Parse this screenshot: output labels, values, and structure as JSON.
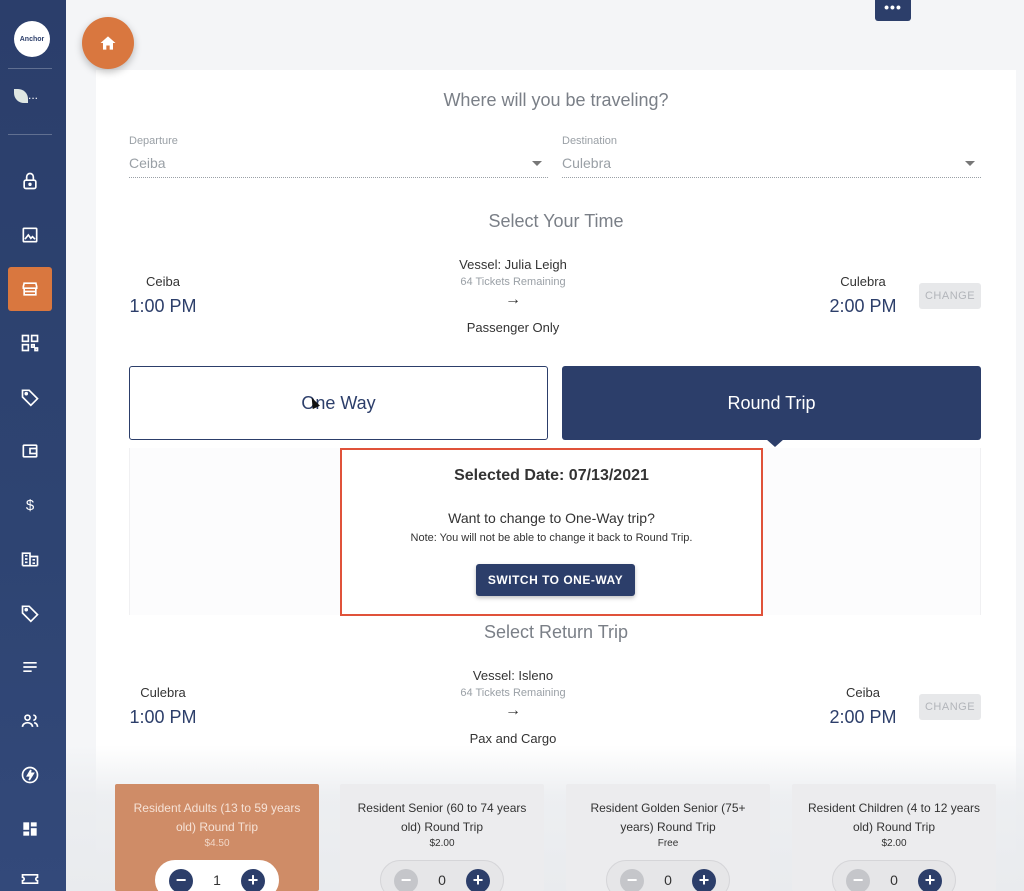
{
  "sidebar": {
    "logo_text": "Anchor",
    "org_label": "...",
    "items": [
      {
        "icon": "lock-icon"
      },
      {
        "icon": "image-icon"
      },
      {
        "icon": "storefront-icon",
        "active": true
      },
      {
        "icon": "qr-code-icon"
      },
      {
        "icon": "tag-heart-icon"
      },
      {
        "icon": "wallet-icon"
      },
      {
        "icon": "dollar-icon",
        "glyph": "$"
      },
      {
        "icon": "building-icon"
      },
      {
        "icon": "label-icon"
      },
      {
        "icon": "list-icon"
      },
      {
        "icon": "people-icon"
      },
      {
        "icon": "bolt-icon"
      },
      {
        "icon": "dashboard-icon"
      },
      {
        "icon": "ticket-icon"
      }
    ]
  },
  "topbar": {
    "more_label": "•••"
  },
  "route": {
    "heading": "Where will you be traveling?",
    "departure": {
      "label": "Departure",
      "value": "Ceiba"
    },
    "destination": {
      "label": "Destination",
      "value": "Culebra"
    }
  },
  "outbound": {
    "heading": "Select Your Time",
    "from": "Ceiba",
    "from_time": "1:00 PM",
    "to": "Culebra",
    "to_time": "2:00 PM",
    "vessel": "Vessel: Julia Leigh",
    "remaining": "64 Tickets Remaining",
    "arrow": "→",
    "service": "Passenger Only",
    "change_label": "CHANGE"
  },
  "trip_type": {
    "one_way": "One Way",
    "round_trip": "Round Trip",
    "selected": "round_trip"
  },
  "modal": {
    "date": "Selected Date: 07/13/2021",
    "question": "Want to change to One-Way trip?",
    "note": "Note: You will not be able to change it back to Round Trip.",
    "button": "SWITCH TO ONE-WAY"
  },
  "return": {
    "heading": "Select Return Trip",
    "from": "Culebra",
    "from_time": "1:00 PM",
    "to": "Ceiba",
    "to_time": "2:00 PM",
    "vessel": "Vessel: Isleno",
    "remaining": "64 Tickets Remaining",
    "arrow": "→",
    "service": "Pax and Cargo",
    "change_label": "CHANGE"
  },
  "tickets": [
    {
      "title": "Resident Adults (13 to 59 years old) Round Trip",
      "price": "$4.50",
      "qty": "1"
    },
    {
      "title": "Resident Senior (60 to 74 years old) Round Trip",
      "price": "$2.00",
      "qty": "0"
    },
    {
      "title": "Resident Golden Senior (75+ years) Round Trip",
      "price": "Free",
      "qty": "0"
    },
    {
      "title": "Resident Children (4 to 12 years old) Round Trip",
      "price": "$2.00",
      "qty": "0"
    }
  ],
  "colors": {
    "navy": "#2c3e6a",
    "orange": "#d9773f",
    "highlight": "#e0523a"
  }
}
